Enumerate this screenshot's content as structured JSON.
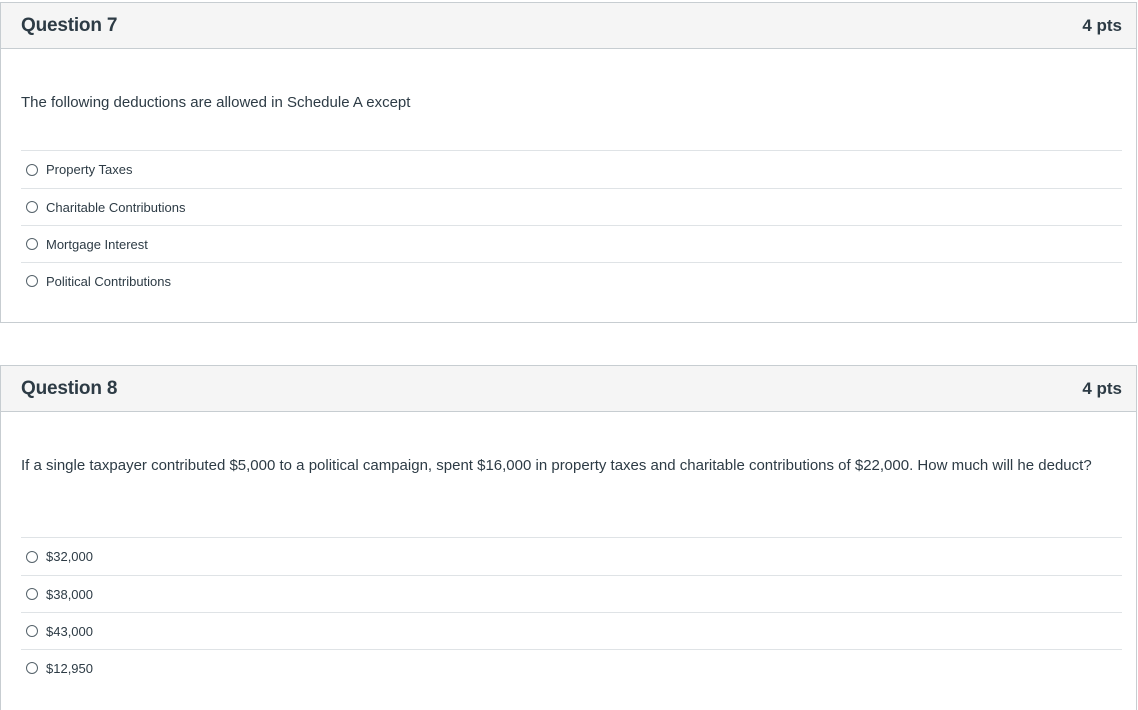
{
  "questions": [
    {
      "title": "Question 7",
      "points": "4 pts",
      "text": "The following deductions are allowed in Schedule A except",
      "answers": [
        "Property Taxes",
        "Charitable Contributions",
        "Mortgage Interest",
        "Political Contributions"
      ]
    },
    {
      "title": "Question 8",
      "points": "4 pts",
      "text": "If a single taxpayer contributed $5,000 to a political campaign, spent $16,000 in property taxes and charitable contributions of $22,000. How much will he deduct?",
      "answers": [
        "$32,000",
        "$38,000",
        "$43,000",
        "$12,950"
      ]
    }
  ]
}
